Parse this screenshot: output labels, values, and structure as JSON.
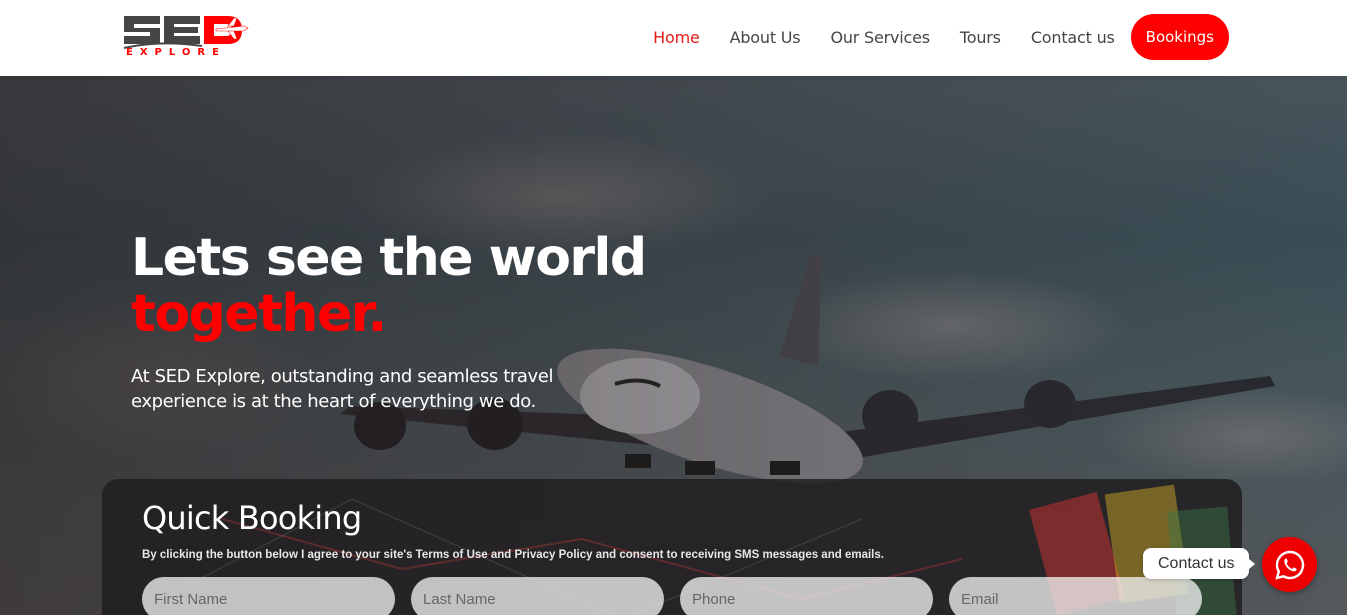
{
  "brand": {
    "name": "SED",
    "tagline": "EXPLORE",
    "icon": "airplane-icon",
    "colors": {
      "primary": "#ff0000",
      "dark": "#454545"
    }
  },
  "nav": {
    "items": [
      {
        "label": "Home",
        "active": true
      },
      {
        "label": "About Us",
        "active": false
      },
      {
        "label": "Our Services",
        "active": false
      },
      {
        "label": "Tours",
        "active": false
      },
      {
        "label": "Contact us",
        "active": false
      }
    ],
    "cta_label": "Bookings"
  },
  "hero": {
    "title_line1": "Lets see the world",
    "title_line2": "together.",
    "subtitle": "At SED Explore, outstanding and seamless travel experience is at the heart of everything we do."
  },
  "booking": {
    "title": "Quick Booking",
    "note": "By clicking the button below I agree to your site's Terms of Use and Privacy Policy and consent to receiving SMS messages and emails.",
    "fields": [
      {
        "placeholder": "First Name",
        "value": ""
      },
      {
        "placeholder": "Last Name",
        "value": ""
      },
      {
        "placeholder": "Phone",
        "value": ""
      },
      {
        "placeholder": "Email",
        "value": ""
      }
    ]
  },
  "contact_widget": {
    "label": "Contact us",
    "icon": "whatsapp-icon"
  }
}
